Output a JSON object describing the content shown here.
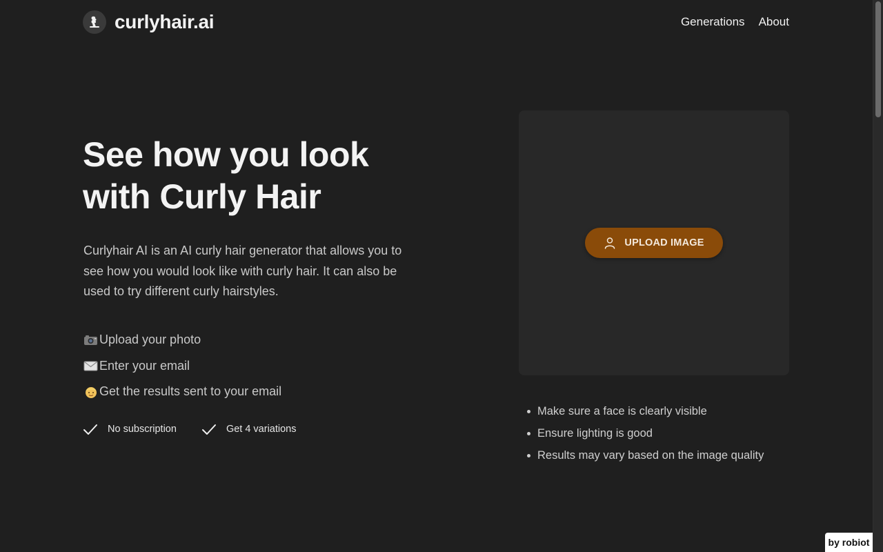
{
  "header": {
    "logo_icon": "curly-hair-profile-icon",
    "brand_name": "curlyhair.ai",
    "nav": [
      {
        "label": "Generations"
      },
      {
        "label": "About"
      }
    ]
  },
  "hero": {
    "title_line1": "See how you look",
    "title_line2": "with Curly Hair",
    "description": "Curlyhair AI is an AI curly hair generator that allows you to see how you would look like with curly hair. It can also be used to try different curly hairstyles.",
    "steps": [
      {
        "icon": "camera-icon",
        "label": "Upload your photo"
      },
      {
        "icon": "envelope-icon",
        "label": "Enter your email"
      },
      {
        "icon": "person-face-icon",
        "label": "Get the results sent to your email"
      }
    ],
    "features": [
      {
        "icon": "check-icon",
        "label": "No subscription"
      },
      {
        "icon": "check-icon",
        "label": "Get 4 variations"
      }
    ]
  },
  "upload": {
    "button_label": "UPLOAD IMAGE",
    "button_icon": "user-icon",
    "tips": [
      "Make sure a face is clearly visible",
      "Ensure lighting is good",
      "Results may vary based on the image quality"
    ]
  },
  "badge": {
    "label": "by robiot"
  },
  "colors": {
    "background": "#1f1f1f",
    "panel": "#282828",
    "accent": "#8a4b09",
    "text": "#ececec"
  }
}
